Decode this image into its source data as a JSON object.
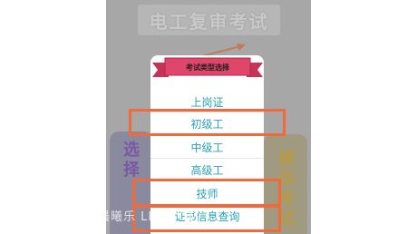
{
  "background": {
    "title": "电工复审考试",
    "left_panel_text": "选择",
    "right_panel_text": "模拟考试"
  },
  "dialog": {
    "title": "考试类型选择",
    "items": [
      {
        "label": "上岗证"
      },
      {
        "label": "初级工"
      },
      {
        "label": "中级工"
      },
      {
        "label": "高级工"
      },
      {
        "label": "技师"
      },
      {
        "label": "证书信息查询"
      }
    ]
  },
  "watermark": "晨曦乐        LLU.COM",
  "colors": {
    "accent": "#2aa2b6",
    "highlight": "#f26a3c",
    "ribbon": "#e0456a",
    "overlay": "#a7a7a7"
  }
}
